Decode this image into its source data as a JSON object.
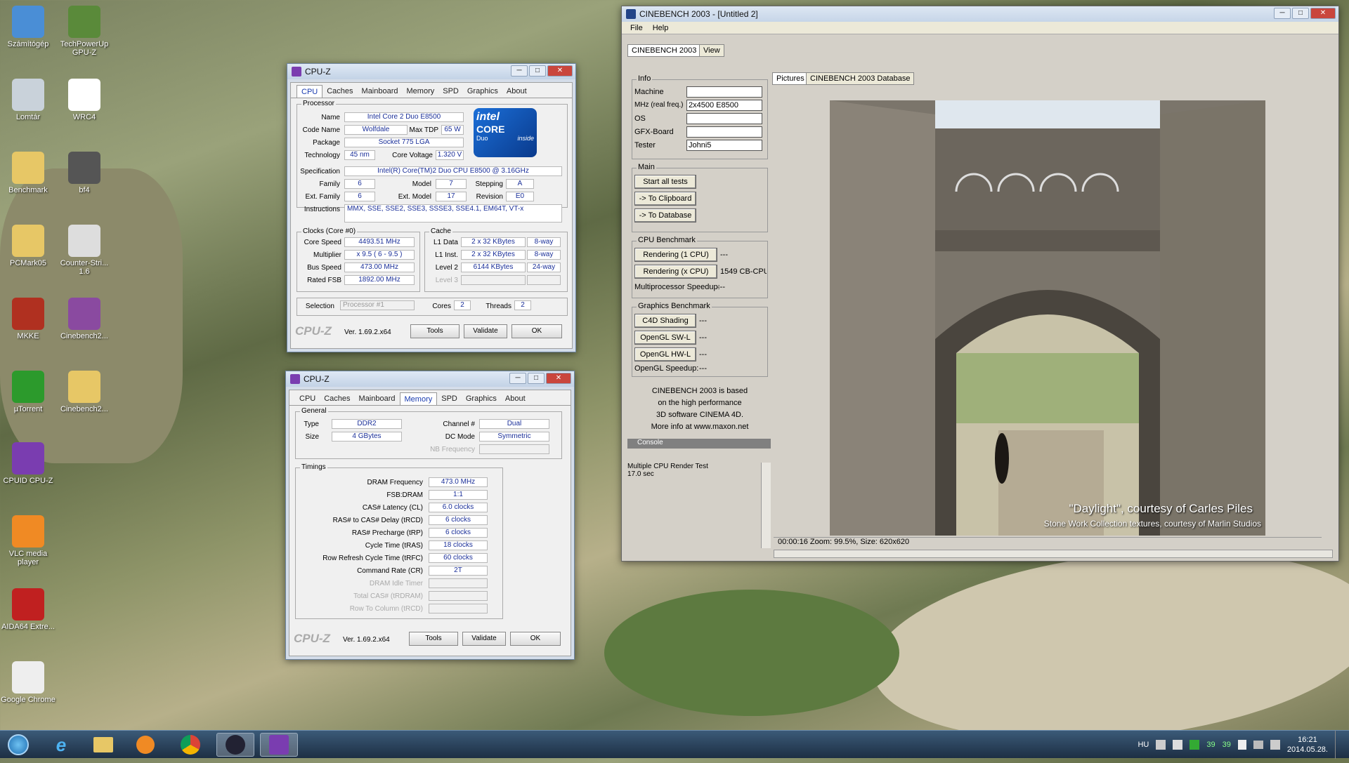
{
  "desktop": {
    "icons": [
      {
        "label": "Számítógép",
        "glyph": "computer-icon"
      },
      {
        "label": "TechPowerUp GPU-Z",
        "glyph": "gpu-z-icon"
      },
      {
        "label": "Lomtár",
        "glyph": "recycle-bin-icon"
      },
      {
        "label": "WRC4",
        "glyph": "wrc4-icon"
      },
      {
        "label": "Benchmark",
        "glyph": "folder-icon"
      },
      {
        "label": "bf4",
        "glyph": "bf4-icon"
      },
      {
        "label": "PCMark05",
        "glyph": "folder-icon"
      },
      {
        "label": "Counter-Stri... 1.6",
        "glyph": "cs-icon"
      },
      {
        "label": "MKKE",
        "glyph": "mk-icon"
      },
      {
        "label": "Cinebench2...",
        "glyph": "rar-icon"
      },
      {
        "label": "µTorrent",
        "glyph": "utorrent-icon"
      },
      {
        "label": "Cinebench2...",
        "glyph": "folder-icon"
      },
      {
        "label": "CPUID CPU-Z",
        "glyph": "cpuz-icon"
      },
      {
        "label": "VLC media player",
        "glyph": "vlc-icon"
      },
      {
        "label": "AIDA64 Extre...",
        "glyph": "aida-icon"
      },
      {
        "label": "Google Chrome",
        "glyph": "chrome-icon"
      }
    ]
  },
  "cpuz1": {
    "title": "CPU-Z",
    "tabs": [
      "CPU",
      "Caches",
      "Mainboard",
      "Memory",
      "SPD",
      "Graphics",
      "About"
    ],
    "active": "CPU",
    "processor_title": "Processor",
    "name_label": "Name",
    "name": "Intel Core 2 Duo E8500",
    "codename_label": "Code Name",
    "codename": "Wolfdale",
    "maxtdp_label": "Max TDP",
    "maxtdp": "65 W",
    "package_label": "Package",
    "package": "Socket 775 LGA",
    "tech_label": "Technology",
    "tech": "45 nm",
    "voltage_label": "Core Voltage",
    "voltage": "1.320 V",
    "spec_label": "Specification",
    "spec": "Intel(R) Core(TM)2 Duo CPU     E8500  @ 3.16GHz",
    "family_label": "Family",
    "family": "6",
    "model_label": "Model",
    "model": "7",
    "stepping_label": "Stepping",
    "stepping": "A",
    "extfamily_label": "Ext. Family",
    "extfamily": "6",
    "extmodel_label": "Ext. Model",
    "extmodel": "17",
    "revision_label": "Revision",
    "revision": "E0",
    "instr_label": "Instructions",
    "instr": "MMX, SSE, SSE2, SSE3, SSSE3, SSE4.1, EM64T, VT-x",
    "clocks_title": "Clocks (Core #0)",
    "cache_title": "Cache",
    "corespeed_label": "Core Speed",
    "corespeed": "4493.51 MHz",
    "mult_label": "Multiplier",
    "mult": "x 9.5 ( 6 - 9.5 )",
    "bus_label": "Bus Speed",
    "bus": "473.00 MHz",
    "fsb_label": "Rated FSB",
    "fsb": "1892.00 MHz",
    "l1d_label": "L1 Data",
    "l1d": "2 x 32 KBytes",
    "l1d_w": "8-way",
    "l1i_label": "L1 Inst.",
    "l1i": "2 x 32 KBytes",
    "l1i_w": "8-way",
    "l2_label": "Level 2",
    "l2": "6144 KBytes",
    "l2_w": "24-way",
    "l3_label": "Level 3",
    "selection_label": "Selection",
    "selection": "Processor #1",
    "cores_label": "Cores",
    "cores": "2",
    "threads_label": "Threads",
    "threads": "2",
    "brand": "CPU-Z",
    "version": "Ver. 1.69.2.x64",
    "tools": "Tools",
    "validate": "Validate",
    "ok": "OK",
    "intel_text": "intel",
    "core_text": "CORE",
    "duo_text": "Duo",
    "inside_text": "inside"
  },
  "cpuz2": {
    "title": "CPU-Z",
    "tabs": [
      "CPU",
      "Caches",
      "Mainboard",
      "Memory",
      "SPD",
      "Graphics",
      "About"
    ],
    "active": "Memory",
    "general_title": "General",
    "type_label": "Type",
    "type": "DDR2",
    "channel_label": "Channel #",
    "channel": "Dual",
    "size_label": "Size",
    "size": "4 GBytes",
    "dcmode_label": "DC Mode",
    "dcmode": "Symmetric",
    "nbfreq_label": "NB Frequency",
    "timings_title": "Timings",
    "timings": [
      {
        "label": "DRAM Frequency",
        "value": "473.0 MHz",
        "dim": false
      },
      {
        "label": "FSB:DRAM",
        "value": "1:1",
        "dim": false
      },
      {
        "label": "CAS# Latency (CL)",
        "value": "6.0 clocks",
        "dim": false
      },
      {
        "label": "RAS# to CAS# Delay (tRCD)",
        "value": "6 clocks",
        "dim": false
      },
      {
        "label": "RAS# Precharge (tRP)",
        "value": "6 clocks",
        "dim": false
      },
      {
        "label": "Cycle Time (tRAS)",
        "value": "18 clocks",
        "dim": false
      },
      {
        "label": "Row Refresh Cycle Time (tRFC)",
        "value": "60 clocks",
        "dim": false
      },
      {
        "label": "Command Rate (CR)",
        "value": "2T",
        "dim": false
      },
      {
        "label": "DRAM Idle Timer",
        "value": "",
        "dim": true
      },
      {
        "label": "Total CAS# (tRDRAM)",
        "value": "",
        "dim": true
      },
      {
        "label": "Row To Column (tRCD)",
        "value": "",
        "dim": true
      }
    ],
    "brand": "CPU-Z",
    "version": "Ver. 1.69.2.x64",
    "tools": "Tools",
    "validate": "Validate",
    "ok": "OK"
  },
  "cinebench": {
    "title": "CINEBENCH 2003 - [Untitled 2]",
    "menu_file": "File",
    "menu_help": "Help",
    "tab_main": "CINEBENCH 2003",
    "tab_view": "View",
    "info_title": "Info",
    "machine_label": "Machine",
    "machine": "",
    "mhz_label": "MHz (real freq.)",
    "mhz": "2x4500 E8500",
    "os_label": "OS",
    "os": "",
    "gfx_label": "GFX-Board",
    "gfx": "",
    "tester_label": "Tester",
    "tester": "Johni5",
    "main_title": "Main",
    "start_all": "Start all tests",
    "to_clipboard": "-> To Clipboard",
    "to_database": "-> To Database",
    "cpu_title": "CPU Benchmark",
    "render1": "Rendering (1 CPU)",
    "render1_val": "---",
    "renderx": "Rendering (x CPU)",
    "renderx_val": "1549 CB-CPU",
    "mp_speedup": "Multiprocessor Speedup:",
    "mp_val": "---",
    "gfx_title": "Graphics Benchmark",
    "c4d": "C4D Shading",
    "c4d_val": "---",
    "ogl_sw": "OpenGL SW-L",
    "ogl_sw_val": "---",
    "ogl_hw": "OpenGL HW-L",
    "ogl_hw_val": "---",
    "ogl_speedup": "OpenGL Speedup:",
    "ogl_val": "---",
    "about_lines": [
      "CINEBENCH 2003 is based",
      "on the high performance",
      "3D software CINEMA 4D.",
      "More info at www.maxon.net"
    ],
    "console_title": "Console",
    "console_lines": [
      "Multiple CPU Render Test",
      "17.0 sec"
    ],
    "tab_pictures": "Pictures",
    "tab_db": "CINEBENCH 2003 Database",
    "credit1": "\"Daylight\", courtesy of Carles Piles",
    "credit2": "Stone Work Collection textures, courtesy of Marlin Studios",
    "status": "00:00:16   Zoom: 99.5%, Size: 620x620"
  },
  "tray": {
    "lang": "HU",
    "n1": "39",
    "n2": "39",
    "time": "16:21",
    "date": "2014.05.28."
  }
}
